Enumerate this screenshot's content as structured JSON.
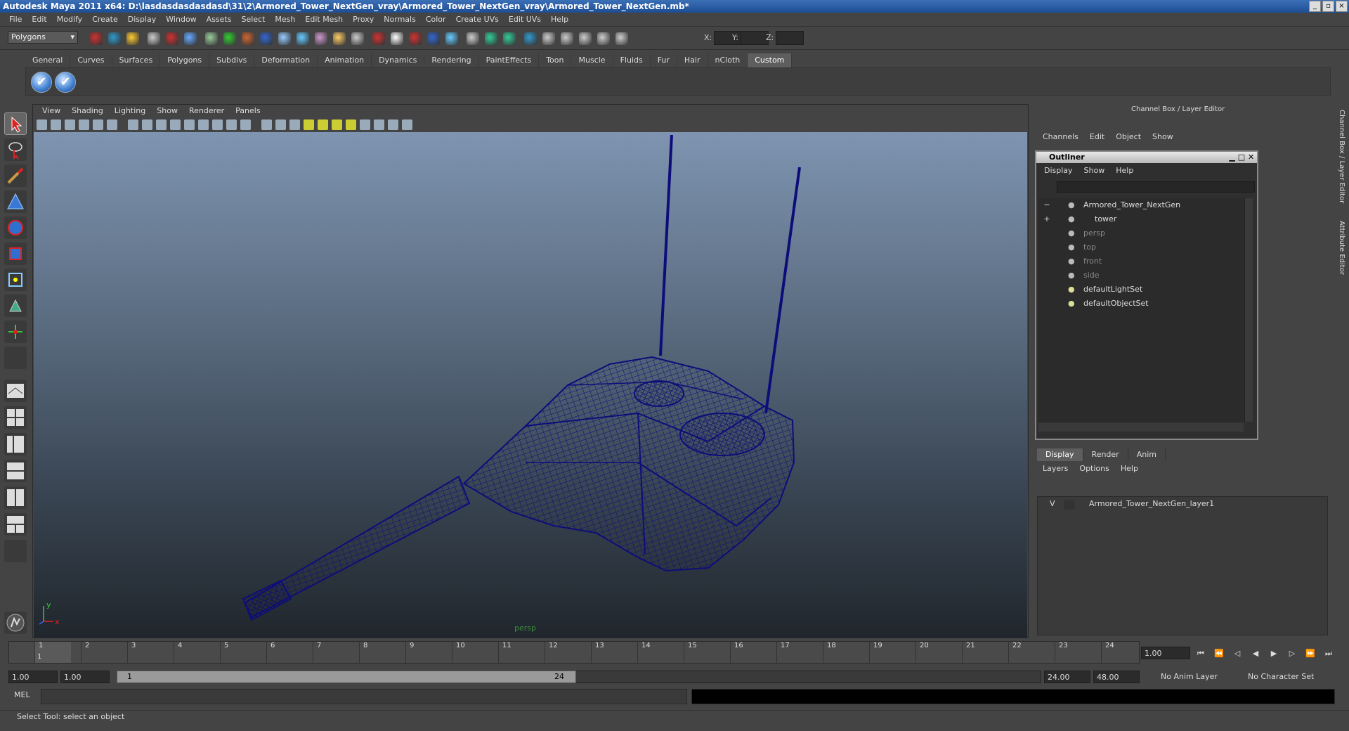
{
  "window": {
    "title": "Autodesk Maya 2011 x64: D:\\lasdasdasdasdasd\\31\\2\\Armored_Tower_NextGen_vray\\Armored_Tower_NextGen_vray\\Armored_Tower_NextGen.mb*"
  },
  "menu": [
    "File",
    "Edit",
    "Modify",
    "Create",
    "Display",
    "Window",
    "Assets",
    "Select",
    "Mesh",
    "Edit Mesh",
    "Proxy",
    "Normals",
    "Color",
    "Create UVs",
    "Edit UVs",
    "Help"
  ],
  "status_line": {
    "mode": "Polygons",
    "x_label": "X:",
    "y_label": "Y:",
    "z_label": "Z:"
  },
  "shelf": {
    "tabs": [
      "General",
      "Curves",
      "Surfaces",
      "Polygons",
      "Subdivs",
      "Deformation",
      "Animation",
      "Dynamics",
      "Rendering",
      "PaintEffects",
      "Toon",
      "Muscle",
      "Fluids",
      "Fur",
      "Hair",
      "nCloth",
      "Custom"
    ],
    "active": "Custom"
  },
  "viewport": {
    "menu": [
      "View",
      "Shading",
      "Lighting",
      "Show",
      "Renderer",
      "Panels"
    ],
    "camera": "persp",
    "axis_x": "x",
    "axis_y": "y",
    "wire_color": "#0d0d7a"
  },
  "channel_box": {
    "title": "Channel Box / Layer Editor",
    "menu": [
      "Channels",
      "Edit",
      "Object",
      "Show"
    ]
  },
  "outliner": {
    "title": "Outliner",
    "menu": [
      "Display",
      "Show",
      "Help"
    ],
    "items": [
      {
        "label": "Armored_Tower_NextGen",
        "dim": false,
        "icon": "transform-icon",
        "expander": "−"
      },
      {
        "label": "tower",
        "dim": false,
        "icon": "mesh-icon",
        "expander": "+"
      },
      {
        "label": "persp",
        "dim": true,
        "icon": "camera-icon",
        "expander": ""
      },
      {
        "label": "top",
        "dim": true,
        "icon": "camera-icon",
        "expander": ""
      },
      {
        "label": "front",
        "dim": true,
        "icon": "camera-icon",
        "expander": ""
      },
      {
        "label": "side",
        "dim": true,
        "icon": "camera-icon",
        "expander": ""
      },
      {
        "label": "defaultLightSet",
        "dim": false,
        "icon": "set-icon",
        "expander": ""
      },
      {
        "label": "defaultObjectSet",
        "dim": false,
        "icon": "set-icon",
        "expander": ""
      }
    ]
  },
  "layer_editor": {
    "tabs": [
      "Display",
      "Render",
      "Anim"
    ],
    "active": "Display",
    "menu": [
      "Layers",
      "Options",
      "Help"
    ],
    "layers": [
      {
        "visible": "V",
        "name": "Armored_Tower_NextGen_layer1"
      }
    ]
  },
  "side_tabs": [
    "Channel Box / Layer Editor",
    "Attribute Editor"
  ],
  "timeline": {
    "ticks": [
      "1",
      "2",
      "3",
      "4",
      "5",
      "6",
      "7",
      "8",
      "9",
      "10",
      "11",
      "12",
      "13",
      "14",
      "15",
      "16",
      "17",
      "18",
      "19",
      "20",
      "21",
      "22",
      "23",
      "24"
    ],
    "current_frame": "1.00",
    "current_tick": "1"
  },
  "range": {
    "start": "1.00",
    "playback_start": "1.00",
    "handle_start": "1",
    "handle_end": "24",
    "playback_end": "24.00",
    "end": "48.00",
    "anim_layer": "No Anim Layer",
    "character_set": "No Character Set"
  },
  "command_line": {
    "label": "MEL"
  },
  "help_line": {
    "text": "Select Tool: select an object"
  }
}
